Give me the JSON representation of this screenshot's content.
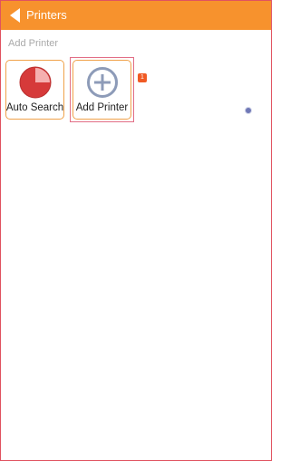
{
  "header": {
    "back_icon": "back-arrow-icon",
    "title": "Printers"
  },
  "section": {
    "label": "Add Printer"
  },
  "tiles": [
    {
      "label": "Auto Search",
      "icon": "auto-search-icon"
    },
    {
      "label": "Add Printer",
      "icon": "add-circle-icon"
    }
  ],
  "badge": {
    "count": "1"
  },
  "colors": {
    "topbar": "#f7922d",
    "tile_border": "#f0a24a",
    "accent_red": "#e0525f",
    "badge": "#f05a24"
  }
}
